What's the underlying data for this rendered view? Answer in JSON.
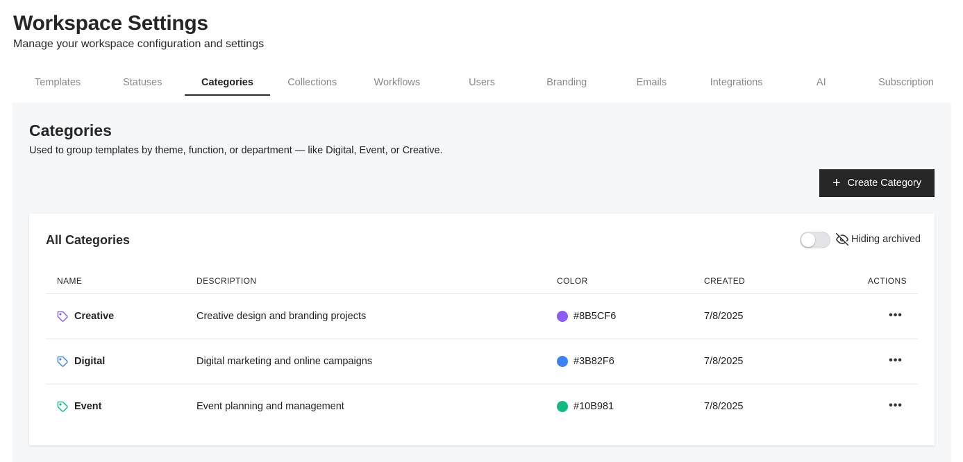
{
  "header": {
    "title": "Workspace Settings",
    "subtitle": "Manage your workspace configuration and settings"
  },
  "tabs": [
    {
      "label": "Templates",
      "active": false
    },
    {
      "label": "Statuses",
      "active": false
    },
    {
      "label": "Categories",
      "active": true
    },
    {
      "label": "Collections",
      "active": false
    },
    {
      "label": "Workflows",
      "active": false
    },
    {
      "label": "Users",
      "active": false
    },
    {
      "label": "Branding",
      "active": false
    },
    {
      "label": "Emails",
      "active": false
    },
    {
      "label": "Integrations",
      "active": false
    },
    {
      "label": "AI",
      "active": false
    },
    {
      "label": "Subscription",
      "active": false
    }
  ],
  "section": {
    "title": "Categories",
    "description": "Used to group templates by theme, function, or department — like Digital, Event, or Creative.",
    "create_label": "Create Category"
  },
  "card": {
    "title": "All Categories",
    "archive_label": "Hiding archived",
    "columns": {
      "name": "NAME",
      "description": "DESCRIPTION",
      "color": "COLOR",
      "created": "CREATED",
      "actions": "ACTIONS"
    },
    "rows": [
      {
        "name": "Creative",
        "description": "Creative design and branding projects",
        "color": "#8B5CF6",
        "created": "7/8/2025"
      },
      {
        "name": "Digital",
        "description": "Digital marketing and online campaigns",
        "color": "#3B82F6",
        "created": "7/8/2025"
      },
      {
        "name": "Event",
        "description": "Event planning and management",
        "color": "#10B981",
        "created": "7/8/2025"
      }
    ]
  },
  "icons": {
    "tag": "tag-icon",
    "eye_off": "eye-off-icon",
    "plus": "plus-icon",
    "more": "more-horizontal-icon"
  }
}
